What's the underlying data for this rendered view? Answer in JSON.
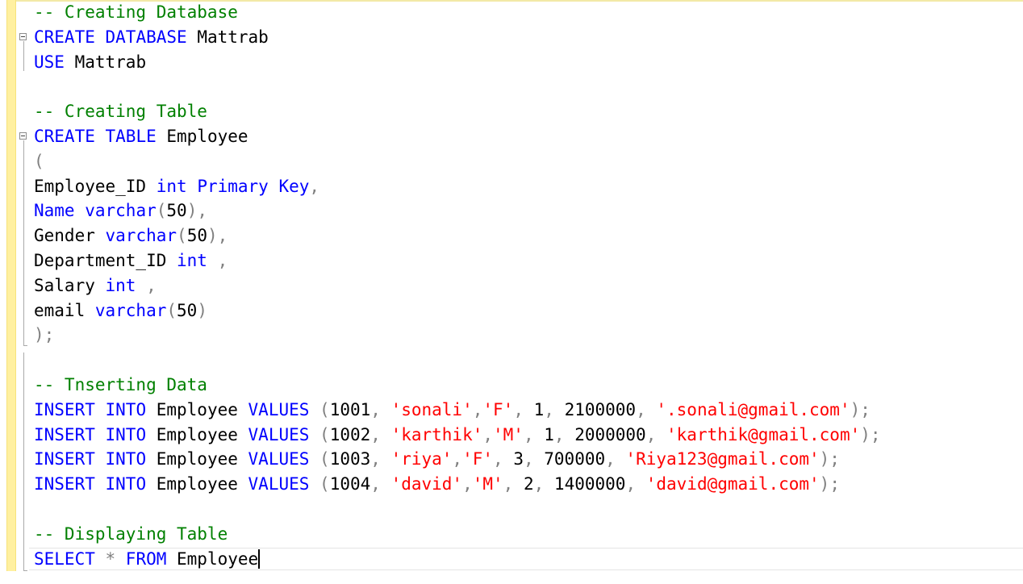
{
  "editor": {
    "language": "sql",
    "lines": [
      [
        {
          "t": "-- Creating Database",
          "c": "cm"
        }
      ],
      [
        {
          "t": "CREATE",
          "c": "kw"
        },
        {
          "t": " ",
          "c": "id"
        },
        {
          "t": "DATABASE",
          "c": "kw"
        },
        {
          "t": " Mattrab",
          "c": "id"
        }
      ],
      [
        {
          "t": "USE",
          "c": "kw"
        },
        {
          "t": " Mattrab",
          "c": "id"
        }
      ],
      [],
      [
        {
          "t": "-- Creating Table",
          "c": "cm"
        }
      ],
      [
        {
          "t": "CREATE",
          "c": "kw"
        },
        {
          "t": " ",
          "c": "id"
        },
        {
          "t": "TABLE",
          "c": "kw"
        },
        {
          "t": " Employee",
          "c": "id"
        }
      ],
      [
        {
          "t": "(",
          "c": "pu"
        }
      ],
      [
        {
          "t": "Employee_ID ",
          "c": "id"
        },
        {
          "t": "int",
          "c": "kw"
        },
        {
          "t": " ",
          "c": "id"
        },
        {
          "t": "Primary",
          "c": "kw"
        },
        {
          "t": " ",
          "c": "id"
        },
        {
          "t": "Key",
          "c": "kw"
        },
        {
          "t": ",",
          "c": "pu"
        }
      ],
      [
        {
          "t": "Name",
          "c": "kw"
        },
        {
          "t": " ",
          "c": "id"
        },
        {
          "t": "varchar",
          "c": "kw"
        },
        {
          "t": "(",
          "c": "pu"
        },
        {
          "t": "50",
          "c": "nm"
        },
        {
          "t": "),",
          "c": "pu"
        }
      ],
      [
        {
          "t": "Gender ",
          "c": "id"
        },
        {
          "t": "varchar",
          "c": "kw"
        },
        {
          "t": "(",
          "c": "pu"
        },
        {
          "t": "50",
          "c": "nm"
        },
        {
          "t": "),",
          "c": "pu"
        }
      ],
      [
        {
          "t": "Department_ID ",
          "c": "id"
        },
        {
          "t": "int",
          "c": "kw"
        },
        {
          "t": " ,",
          "c": "pu"
        }
      ],
      [
        {
          "t": "Salary ",
          "c": "id"
        },
        {
          "t": "int",
          "c": "kw"
        },
        {
          "t": " ,",
          "c": "pu"
        }
      ],
      [
        {
          "t": "email ",
          "c": "id"
        },
        {
          "t": "varchar",
          "c": "kw"
        },
        {
          "t": "(",
          "c": "pu"
        },
        {
          "t": "50",
          "c": "nm"
        },
        {
          "t": ")",
          "c": "pu"
        }
      ],
      [
        {
          "t": ");",
          "c": "pu"
        }
      ],
      [],
      [
        {
          "t": "-- Tnserting Data",
          "c": "cm"
        }
      ],
      [
        {
          "t": "INSERT",
          "c": "kw"
        },
        {
          "t": " ",
          "c": "id"
        },
        {
          "t": "INTO",
          "c": "kw"
        },
        {
          "t": " Employee ",
          "c": "id"
        },
        {
          "t": "VALUES",
          "c": "kw"
        },
        {
          "t": " (",
          "c": "pu"
        },
        {
          "t": "1001",
          "c": "nm"
        },
        {
          "t": ", ",
          "c": "pu"
        },
        {
          "t": "'sonali'",
          "c": "st"
        },
        {
          "t": ",",
          "c": "pu"
        },
        {
          "t": "'F'",
          "c": "st"
        },
        {
          "t": ", ",
          "c": "pu"
        },
        {
          "t": "1",
          "c": "nm"
        },
        {
          "t": ", ",
          "c": "pu"
        },
        {
          "t": "2100000",
          "c": "nm"
        },
        {
          "t": ", ",
          "c": "pu"
        },
        {
          "t": "'.sonali@gmail.com'",
          "c": "st"
        },
        {
          "t": ");",
          "c": "pu"
        }
      ],
      [
        {
          "t": "INSERT",
          "c": "kw"
        },
        {
          "t": " ",
          "c": "id"
        },
        {
          "t": "INTO",
          "c": "kw"
        },
        {
          "t": " Employee ",
          "c": "id"
        },
        {
          "t": "VALUES",
          "c": "kw"
        },
        {
          "t": " (",
          "c": "pu"
        },
        {
          "t": "1002",
          "c": "nm"
        },
        {
          "t": ", ",
          "c": "pu"
        },
        {
          "t": "'karthik'",
          "c": "st"
        },
        {
          "t": ",",
          "c": "pu"
        },
        {
          "t": "'M'",
          "c": "st"
        },
        {
          "t": ", ",
          "c": "pu"
        },
        {
          "t": "1",
          "c": "nm"
        },
        {
          "t": ", ",
          "c": "pu"
        },
        {
          "t": "2000000",
          "c": "nm"
        },
        {
          "t": ", ",
          "c": "pu"
        },
        {
          "t": "'karthik@gmail.com'",
          "c": "st"
        },
        {
          "t": ");",
          "c": "pu"
        }
      ],
      [
        {
          "t": "INSERT",
          "c": "kw"
        },
        {
          "t": " ",
          "c": "id"
        },
        {
          "t": "INTO",
          "c": "kw"
        },
        {
          "t": " Employee ",
          "c": "id"
        },
        {
          "t": "VALUES",
          "c": "kw"
        },
        {
          "t": " (",
          "c": "pu"
        },
        {
          "t": "1003",
          "c": "nm"
        },
        {
          "t": ", ",
          "c": "pu"
        },
        {
          "t": "'riya'",
          "c": "st"
        },
        {
          "t": ",",
          "c": "pu"
        },
        {
          "t": "'F'",
          "c": "st"
        },
        {
          "t": ", ",
          "c": "pu"
        },
        {
          "t": "3",
          "c": "nm"
        },
        {
          "t": ", ",
          "c": "pu"
        },
        {
          "t": "700000",
          "c": "nm"
        },
        {
          "t": ", ",
          "c": "pu"
        },
        {
          "t": "'Riya123@gmail.com'",
          "c": "st"
        },
        {
          "t": ");",
          "c": "pu"
        }
      ],
      [
        {
          "t": "INSERT",
          "c": "kw"
        },
        {
          "t": " ",
          "c": "id"
        },
        {
          "t": "INTO",
          "c": "kw"
        },
        {
          "t": " Employee ",
          "c": "id"
        },
        {
          "t": "VALUES",
          "c": "kw"
        },
        {
          "t": " (",
          "c": "pu"
        },
        {
          "t": "1004",
          "c": "nm"
        },
        {
          "t": ", ",
          "c": "pu"
        },
        {
          "t": "'david'",
          "c": "st"
        },
        {
          "t": ",",
          "c": "pu"
        },
        {
          "t": "'M'",
          "c": "st"
        },
        {
          "t": ", ",
          "c": "pu"
        },
        {
          "t": "2",
          "c": "nm"
        },
        {
          "t": ", ",
          "c": "pu"
        },
        {
          "t": "1400000",
          "c": "nm"
        },
        {
          "t": ", ",
          "c": "pu"
        },
        {
          "t": "'david@gmail.com'",
          "c": "st"
        },
        {
          "t": ");",
          "c": "pu"
        }
      ],
      [],
      [
        {
          "t": "-- Displaying Table",
          "c": "cm"
        }
      ],
      [
        {
          "t": "SELECT",
          "c": "kw"
        },
        {
          "t": " * ",
          "c": "pu"
        },
        {
          "t": "FROM",
          "c": "kw"
        },
        {
          "t": " Employee",
          "c": "id"
        }
      ]
    ],
    "fold_markers": [
      1,
      5
    ],
    "current_line": 22,
    "colors": {
      "comment": "#008000",
      "keyword": "#0000ff",
      "identifier": "#000000",
      "punctuation": "#808080",
      "string": "#ff0000",
      "change_bar": "#fff0a0"
    }
  }
}
